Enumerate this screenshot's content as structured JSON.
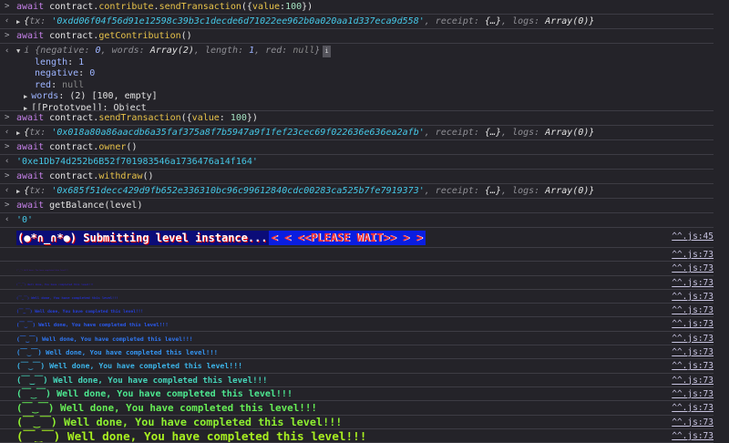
{
  "entries": [
    {
      "type": "input",
      "parts": [
        [
          "kw",
          "await "
        ],
        [
          "",
          "contract."
        ],
        [
          "fn",
          "contribute"
        ],
        [
          "",
          "."
        ],
        [
          "fn",
          "sendTransaction"
        ],
        [
          "",
          "({"
        ],
        [
          "fn",
          "value"
        ],
        [
          "",
          ":"
        ],
        [
          "num",
          "100"
        ],
        [
          "",
          "})"
        ]
      ]
    },
    {
      "type": "tx",
      "tx": "0xdd06f04f56d91e12598c39b3c1decde6d71022ee962b0a020aa1d337eca9d558"
    },
    {
      "type": "input",
      "parts": [
        [
          "kw",
          "await "
        ],
        [
          "",
          "contract."
        ],
        [
          "fn",
          "getContribution"
        ],
        [
          "",
          "()"
        ]
      ]
    },
    {
      "type": "object",
      "summary": {
        "negative": "0",
        "words": "Array(2)",
        "length": "1",
        "red": "null"
      },
      "badge": "i",
      "props": [
        [
          "length",
          "1"
        ],
        [
          "negative",
          "0"
        ],
        [
          "red",
          "null"
        ]
      ],
      "words": "(2) [100, empty]",
      "prototype": "[[Prototype]]: Object"
    },
    {
      "type": "input",
      "parts": [
        [
          "kw",
          "await "
        ],
        [
          "",
          "contract."
        ],
        [
          "fn",
          "sendTransaction"
        ],
        [
          "",
          "({"
        ],
        [
          "fn",
          "value"
        ],
        [
          "",
          ": "
        ],
        [
          "num",
          "100"
        ],
        [
          "",
          "})"
        ]
      ]
    },
    {
      "type": "tx",
      "tx": "0x018a80a86aacdb6a35faf375a8f7b5947a9f1fef23cec69f022636e636ea2afb"
    },
    {
      "type": "input",
      "parts": [
        [
          "kw",
          "await "
        ],
        [
          "",
          "contract."
        ],
        [
          "fn",
          "owner"
        ],
        [
          "",
          "()"
        ]
      ]
    },
    {
      "type": "string",
      "value": "'0xe1Db74d252b6B52f701983546a1736476a14f164'"
    },
    {
      "type": "input",
      "parts": [
        [
          "kw",
          "await "
        ],
        [
          "",
          "contract."
        ],
        [
          "fn",
          "withdraw"
        ],
        [
          "",
          "()"
        ]
      ]
    },
    {
      "type": "tx",
      "tx": "0x685f51decc429d9fb652e336310bc96c99612840cdc00283ca525b7fe7919373"
    },
    {
      "type": "input",
      "parts": [
        [
          "kw",
          "await "
        ],
        [
          "",
          "getBalance(level)"
        ]
      ]
    },
    {
      "type": "string",
      "value": "'0'"
    }
  ],
  "tx_suffix": {
    "receipt": "receipt: ",
    "receipt_val": "{…}",
    "logs": "logs: ",
    "logs_val": "Array(0)"
  },
  "submitting": {
    "text": "(●*∩_∩*●) Submitting level instance...",
    "wait": "<  < <<PLEASE WAIT>> >  >",
    "source": "^^.js:45"
  },
  "welldone": {
    "text": "(￣‿￣) Well done, You have completed this level!!!",
    "source": "^^.js:73",
    "colors": [
      "#242329",
      "#3a1f8a",
      "#2a23b0",
      "#2430c8",
      "#2540e0",
      "#2a5af0",
      "#2f78f5",
      "#3596f2",
      "#3cb4e8",
      "#45d4b8",
      "#4de890",
      "#66ee55",
      "#8ef030",
      "#a8f020"
    ]
  }
}
